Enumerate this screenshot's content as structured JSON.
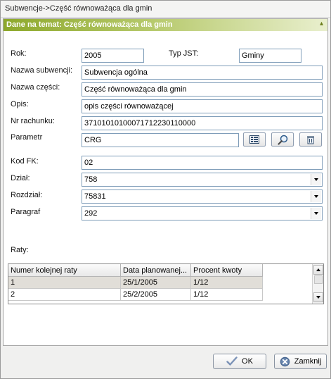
{
  "window": {
    "title": "Subwencje->Część równoważąca dla gmin"
  },
  "panel": {
    "header": "Dane na temat: Część równoważąca dla gmin"
  },
  "form": {
    "rok_label": "Rok:",
    "rok_value": "2005",
    "typjst_label": "Typ JST:",
    "typjst_value": "Gminy",
    "nazwa_subwencji_label": "Nazwa subwencji:",
    "nazwa_subwencji_value": "Subwencja ogólna",
    "nazwa_czesci_label": "Nazwa części:",
    "nazwa_czesci_value": "Część równoważąca dla gmin",
    "opis_label": "Opis:",
    "opis_value": "opis części równoważącej",
    "nr_rachunku_label": "Nr rachunku:",
    "nr_rachunku_value": "37101010100071712230110000",
    "parametr_label": "Parametr",
    "parametr_value": "CRG",
    "kod_fk_label": "Kod FK:",
    "kod_fk_value": "02",
    "dzial_label": "Dział:",
    "dzial_value": "758",
    "rozdzial_label": "Rozdział:",
    "rozdzial_value": "75831",
    "paragraf_label": "Paragraf",
    "paragraf_value": "292"
  },
  "raty": {
    "label": "Raty:",
    "columns": [
      "Numer kolejnej raty",
      "Data  planowanej...",
      "Procent kwoty"
    ],
    "rows": [
      [
        "1",
        "25/1/2005",
        "1/12"
      ],
      [
        "2",
        "25/2/2005",
        "1/12"
      ]
    ]
  },
  "buttons": {
    "ok": "OK",
    "zamknij": "Zamknij"
  },
  "icons": {
    "parametr_buttons": [
      "select-list-icon",
      "search-icon",
      "clear-icon"
    ],
    "ok": "checkmark-icon",
    "zamknij": "close-icon"
  },
  "colors": {
    "header_start": "#8da82b",
    "header_end": "#e9efce",
    "selected_row": "#e1ded8"
  }
}
